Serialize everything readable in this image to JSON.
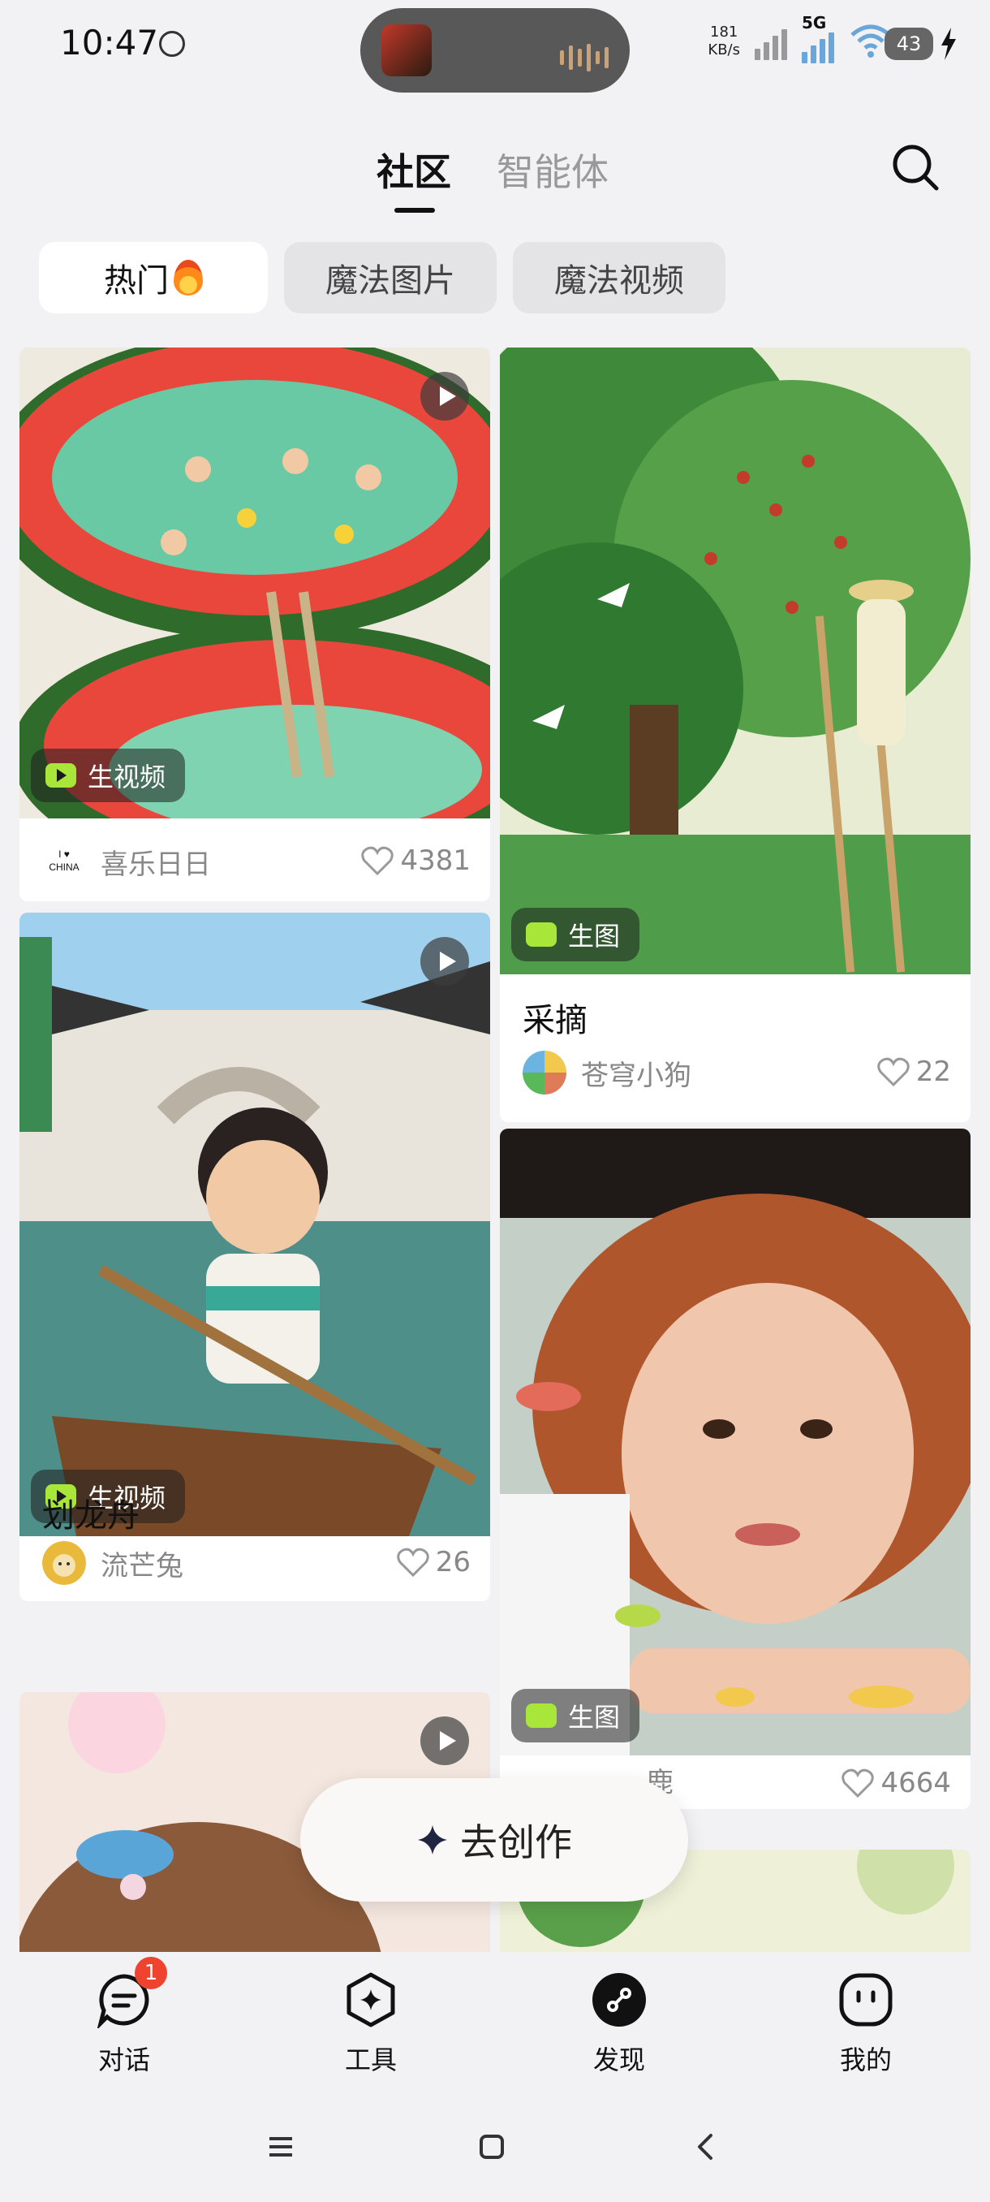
{
  "status_bar": {
    "time": "10:47",
    "net_speed_value": "181",
    "net_speed_unit": "KB/s",
    "network_type": "5G",
    "battery": "43"
  },
  "header": {
    "tabs": [
      {
        "label": "社区",
        "active": true
      },
      {
        "label": "智能体",
        "active": false
      }
    ]
  },
  "chips": [
    {
      "label": "热门",
      "active": true
    },
    {
      "label": "魔法图片",
      "active": false
    },
    {
      "label": "魔法视频",
      "active": false
    }
  ],
  "feed": {
    "left": [
      {
        "badge": "生视频",
        "title": "",
        "author": "喜乐日日",
        "likes": "4381",
        "image": "watermelon-pool-illustration"
      },
      {
        "badge": "生视频",
        "title": "划龙舟",
        "author": "流芒兔",
        "likes": "26",
        "image": "dragon-boat-boy-illustration"
      },
      {
        "badge": "",
        "title": "",
        "author": "",
        "likes": "",
        "image": "girl-portrait-illustration"
      }
    ],
    "right": [
      {
        "badge": "生图",
        "title": "采摘",
        "author": "苍穹小狗",
        "likes": "22",
        "image": "fruit-picking-tree-illustration"
      },
      {
        "badge": "生图",
        "title": "",
        "author": "鹿",
        "likes": "4664",
        "image": "underwater-girl-photo"
      },
      {
        "badge": "",
        "title": "",
        "author": "",
        "likes": "",
        "image": "green-tree-illustration"
      }
    ]
  },
  "create_button": {
    "label": "去创作"
  },
  "bottom_nav": [
    {
      "label": "对话",
      "icon": "chat-icon",
      "badge": "1"
    },
    {
      "label": "工具",
      "icon": "tools-icon"
    },
    {
      "label": "发现",
      "icon": "discover-icon",
      "active": true
    },
    {
      "label": "我的",
      "icon": "profile-icon"
    }
  ],
  "colors": {
    "background": "#f2f2f4",
    "chip_active": "#ffffff",
    "chip_inactive": "#e4e4e6",
    "badge_green": "#a8e63a",
    "notification_red": "#f0432f"
  }
}
